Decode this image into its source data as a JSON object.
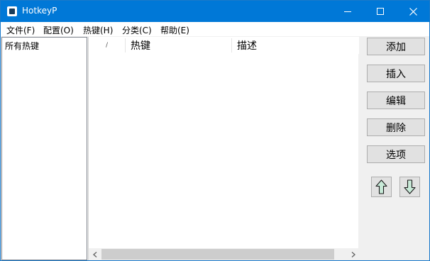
{
  "window": {
    "title": "HotkeyP",
    "minimize_icon": "minimize-icon",
    "maximize_icon": "maximize-icon",
    "close_icon": "close-icon"
  },
  "menu": {
    "items": [
      {
        "label": "文件(F)"
      },
      {
        "label": "配置(O)"
      },
      {
        "label": "热键(H)"
      },
      {
        "label": "分类(C)"
      },
      {
        "label": "帮助(E)"
      }
    ]
  },
  "sidebar": {
    "items": [
      {
        "label": "所有热键"
      }
    ]
  },
  "list": {
    "columns": [
      {
        "label": "/"
      },
      {
        "label": "热键"
      },
      {
        "label": "描述"
      }
    ],
    "rows": []
  },
  "buttons": {
    "add": "添加",
    "insert": "插入",
    "edit": "编辑",
    "delete": "删除",
    "options": "选项"
  },
  "colors": {
    "titlebar": "#0078d7",
    "arrow_fill": "#c8ead8"
  }
}
